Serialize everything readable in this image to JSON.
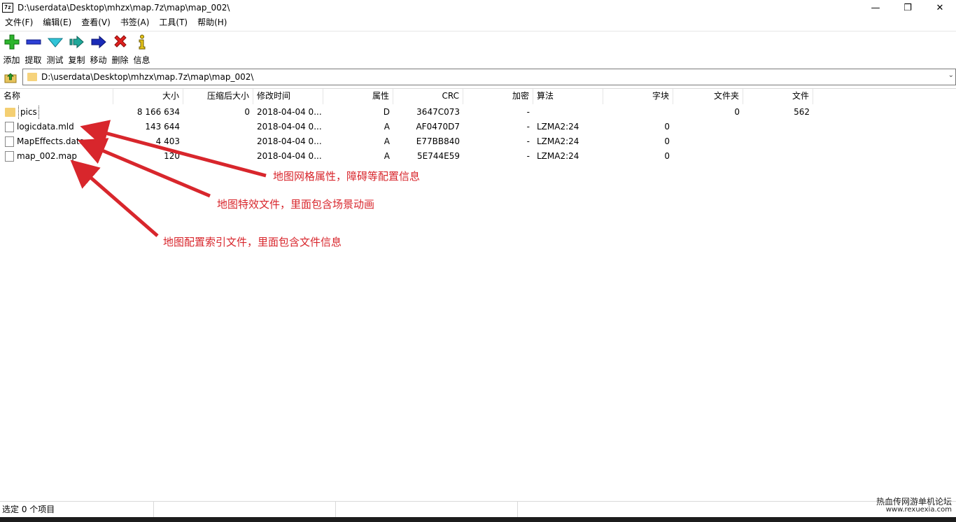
{
  "window": {
    "app_icon": "7z",
    "title": "D:\\userdata\\Desktop\\mhzx\\map.7z\\map\\map_002\\"
  },
  "menu": [
    "文件(F)",
    "编辑(E)",
    "查看(V)",
    "书签(A)",
    "工具(T)",
    "帮助(H)"
  ],
  "toolbar": {
    "add": "添加",
    "extract": "提取",
    "test": "测试",
    "copy": "复制",
    "move": "移动",
    "delete": "删除",
    "info": "信息"
  },
  "address": {
    "path": "D:\\userdata\\Desktop\\mhzx\\map.7z\\map\\map_002\\"
  },
  "columns": {
    "name": "名称",
    "size": "大小",
    "packed": "压缩后大小",
    "modified": "修改时间",
    "attributes": "属性",
    "crc": "CRC",
    "encrypted": "加密",
    "method": "算法",
    "block": "字块",
    "folders": "文件夹",
    "files": "文件"
  },
  "files": [
    {
      "name": "pics",
      "size": "8 166 634",
      "packed": "0",
      "modified": "2018-04-04 0...",
      "attr": "D",
      "crc": "3647C073",
      "encrypted": "-",
      "method": "",
      "block": "",
      "folders": "0",
      "files": "562"
    },
    {
      "name": "logicdata.mld",
      "size": "143 644",
      "packed": "",
      "modified": "2018-04-04 0...",
      "attr": "A",
      "crc": "AF0470D7",
      "encrypted": "-",
      "method": "LZMA2:24",
      "block": "0",
      "folders": "",
      "files": ""
    },
    {
      "name": "MapEffects.data",
      "size": "4 403",
      "packed": "",
      "modified": "2018-04-04 0...",
      "attr": "A",
      "crc": "E77BB840",
      "encrypted": "-",
      "method": "LZMA2:24",
      "block": "0",
      "folders": "",
      "files": ""
    },
    {
      "name": "map_002.map",
      "size": "120",
      "packed": "",
      "modified": "2018-04-04 0...",
      "attr": "A",
      "crc": "5E744E59",
      "encrypted": "-",
      "method": "LZMA2:24",
      "block": "0",
      "folders": "",
      "files": ""
    }
  ],
  "annotations": {
    "logicdata": "地图网格属性，障碍等配置信息",
    "mapeffects": "地图特效文件，里面包含场景动画",
    "mapfile": "地图配置索引文件，里面包含文件信息"
  },
  "status": {
    "selected": "选定 0 个项目"
  },
  "watermark": {
    "line1": "热血传网游单机论坛",
    "line2": "www.rexuexia.com"
  },
  "colors": {
    "annotation": "#d8262c",
    "folder": "#f4cf72"
  }
}
